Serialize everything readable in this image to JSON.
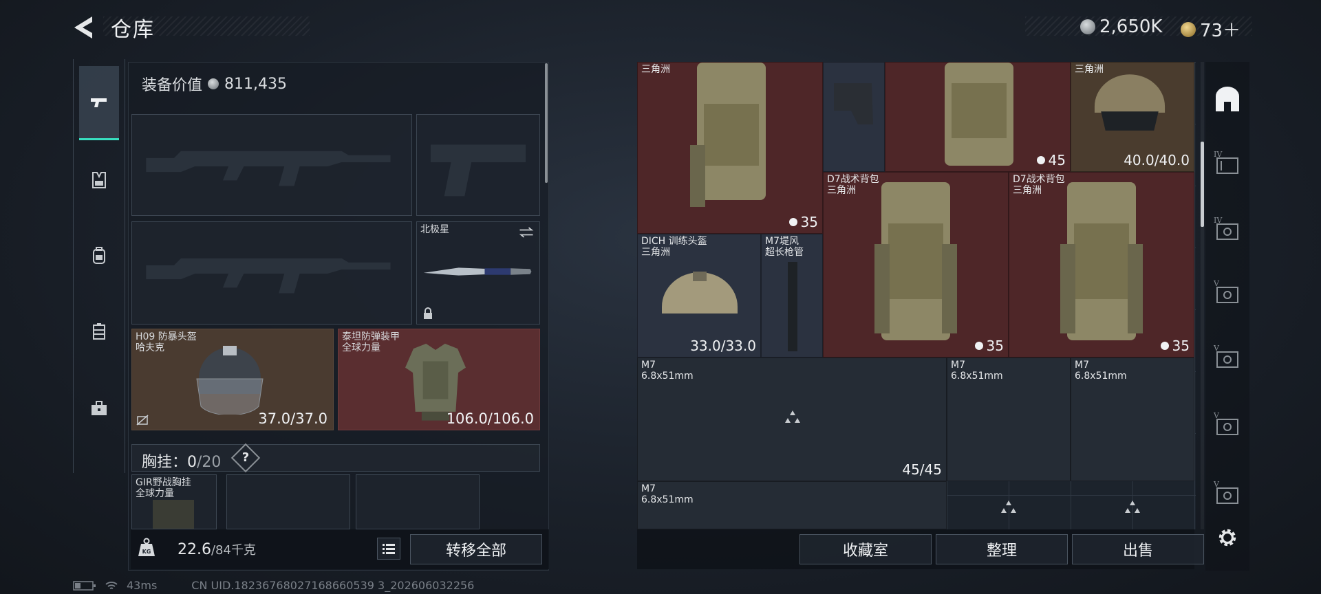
{
  "header": {
    "title": "仓库",
    "currency1": "2,650K",
    "currency2": "73＋"
  },
  "left_panel": {
    "equip_value_label": "装备价值",
    "equip_value": "811,435",
    "melee": {
      "name": "北极星"
    },
    "helmet": {
      "name1": "H09 防暴头盔",
      "name2": "哈夫克",
      "durability": "37.0/37.0"
    },
    "armor": {
      "name1": "泰坦防弹装甲",
      "name2": "全球力量",
      "durability": "106.0/106.0"
    },
    "chest_rig": {
      "label": "胸挂：",
      "count": "0",
      "capacity": "/20",
      "help": "?"
    },
    "rig_item": {
      "name1": "GIR野战胸挂",
      "name2": "全球力量"
    },
    "weight": {
      "value": "22.6",
      "max": "/84千克"
    },
    "transfer_all": "转移全部"
  },
  "status_bar": {
    "ping": "43ms",
    "uid": "CN UID.18236768027168660539 3_202606032256"
  },
  "stash": {
    "items": [
      {
        "id": "bag-top-1",
        "name": "三角洲",
        "count": "35"
      },
      {
        "id": "bag-top-2",
        "count": "45"
      },
      {
        "id": "helmet-top",
        "name": "三角洲",
        "durability": "40.0/40.0"
      },
      {
        "id": "d7-bag-1",
        "name1": "D7战术背包",
        "name2": "三角洲",
        "count": "35"
      },
      {
        "id": "d7-bag-2",
        "name1": "D7战术背包",
        "name2": "三角洲",
        "count": "35"
      },
      {
        "id": "dich-helmet",
        "name1": "DICH 训练头盔",
        "name2": "三角洲",
        "durability": "33.0/33.0"
      },
      {
        "id": "m7-barrel",
        "name1": "M7堤风",
        "name2": "超长枪管"
      },
      {
        "id": "ammo-1",
        "name1": "M7",
        "name2": "6.8x51mm",
        "count": "45/45"
      },
      {
        "id": "ammo-2",
        "name1": "M7",
        "name2": "6.8x51mm"
      },
      {
        "id": "ammo-3",
        "name1": "M7",
        "name2": "6.8x51mm"
      },
      {
        "id": "ammo-4",
        "name1": "M7",
        "name2": "6.8x51mm"
      }
    ]
  },
  "buttons": {
    "collection": "收藏室",
    "sort": "整理",
    "sell": "出售"
  },
  "colors": {
    "accent": "#38e0c0",
    "red_item": "#4e2628",
    "blue_item": "#2b3240"
  }
}
